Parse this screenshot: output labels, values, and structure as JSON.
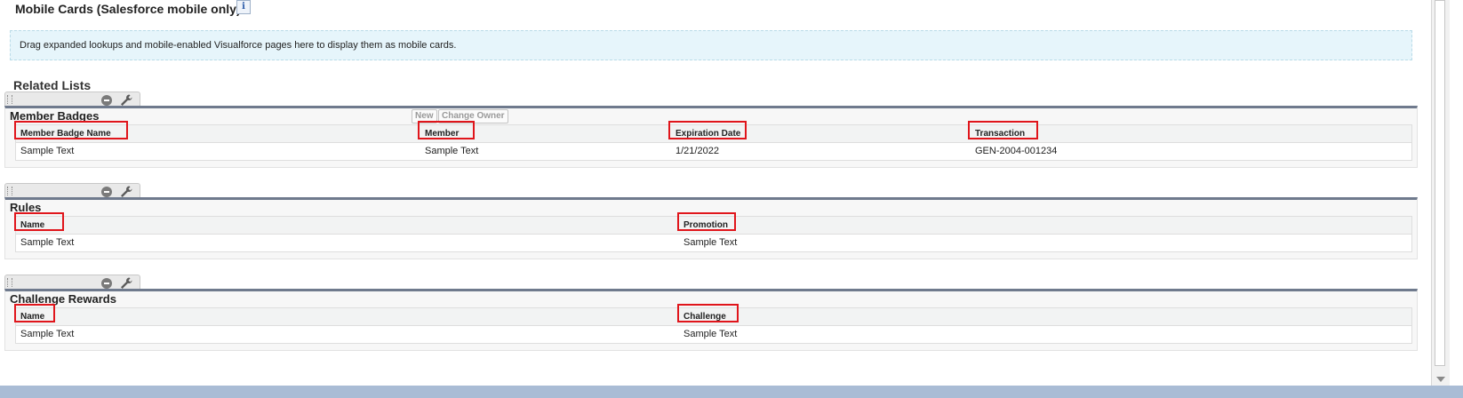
{
  "mobile_cards": {
    "title": "Mobile Cards (Salesforce mobile only)",
    "info_glyph": "i",
    "drop_hint": "Drag expanded lookups and mobile-enabled Visualforce pages here to display them as mobile cards."
  },
  "related_lists": {
    "title": "Related Lists",
    "sections": [
      {
        "title": "Member Badges",
        "buttons": [
          "New",
          "Change Owner"
        ],
        "columns": [
          "Member Badge Name",
          "Member",
          "Expiration Date",
          "Transaction"
        ],
        "row": [
          "Sample Text",
          "Sample Text",
          "1/21/2022",
          "GEN-2004-001234"
        ]
      },
      {
        "title": "Rules",
        "columns": [
          "Name",
          "Promotion"
        ],
        "row": [
          "Sample Text",
          "Sample Text"
        ]
      },
      {
        "title": "Challenge Rewards",
        "columns": [
          "Name",
          "Challenge"
        ],
        "row": [
          "Sample Text",
          "Sample Text"
        ]
      }
    ]
  },
  "icons": {
    "info": "info-icon",
    "remove": "minus-circle-icon",
    "properties": "wrench-icon",
    "drag": "drag-handle-icon"
  },
  "colors": {
    "highlight": "#e0151b",
    "section_border": "#6f7a8d",
    "drop_zone": "#e6f5fb",
    "bottom_bar": "#a9bcd5"
  }
}
